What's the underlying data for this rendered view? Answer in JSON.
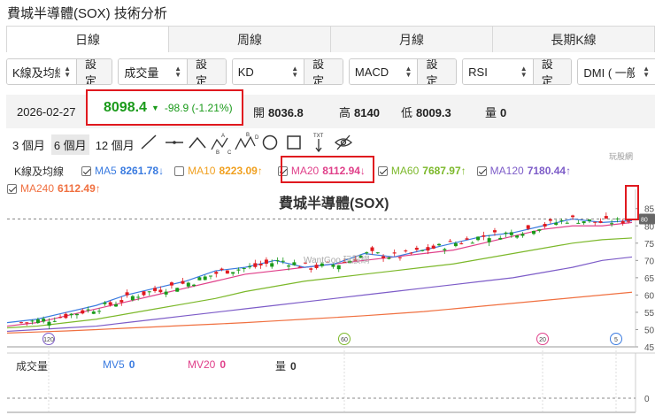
{
  "title": "費城半導體(SOX) 技術分析",
  "tabs": [
    "日線",
    "周線",
    "月線",
    "長期K線"
  ],
  "selectors": [
    {
      "value": "K線及均線",
      "button": "設定"
    },
    {
      "value": "成交量",
      "button": "設定"
    },
    {
      "value": "KD",
      "button": "設定"
    },
    {
      "value": "MACD",
      "button": "設定"
    },
    {
      "value": "RSI",
      "button": "設定"
    },
    {
      "value": "DMI ( 一般",
      "button": ""
    }
  ],
  "quote": {
    "date": "2026-02-27",
    "price": "8098.4",
    "price_arrow": "▼",
    "change": "-98.9 (-1.21%)",
    "open_label": "開",
    "open": "8036.8",
    "high_label": "高",
    "high": "8140",
    "low_label": "低",
    "low": "8009.3",
    "vol_label": "量",
    "vol": "0"
  },
  "ranges": [
    "3 個月",
    "6 個月",
    "12 個月"
  ],
  "legend": {
    "kline": "K線及均線",
    "ma5": {
      "label": "MA5",
      "value": "8261.78",
      "arrow": "↓"
    },
    "ma10": {
      "label": "MA10",
      "value": "8223.09",
      "arrow": "↑"
    },
    "ma20": {
      "label": "MA20",
      "value": "8112.94",
      "arrow": "↓"
    },
    "ma60": {
      "label": "MA60",
      "value": "7687.97",
      "arrow": "↑"
    },
    "ma120": {
      "label": "MA120",
      "value": "7180.44",
      "arrow": "↑"
    },
    "ma240": {
      "label": "MA240",
      "value": "6112.49",
      "arrow": "↑"
    }
  },
  "colors": {
    "ma5": "#3a7be0",
    "ma10": "#f0a020",
    "ma20": "#e0408a",
    "ma60": "#7cb82a",
    "ma120": "#7d5cc8",
    "ma240": "#f07040",
    "up": "#e0191f",
    "down": "#1a9a1a",
    "highlight": "#e0191f"
  },
  "chart_title": "費城半導體(SOX)",
  "watermark": "WantGoo 玩股網",
  "logo": "玩股網",
  "volume": {
    "title": "成交量",
    "ma5": "MV5",
    "ma5_val": "0",
    "ma20": "MV20",
    "ma20_val": "0",
    "vol": "量",
    "vol_val": "0",
    "zero": "0"
  },
  "chart_data": {
    "type": "line",
    "title": "費城半導體(SOX)",
    "y_ticks": [
      45,
      50,
      55,
      60,
      65,
      70,
      75,
      80,
      85
    ],
    "ylim": [
      45,
      88
    ],
    "current_price_tag": "80",
    "period_markers": [
      "120",
      "60",
      "20",
      "5"
    ],
    "series": [
      {
        "name": "MA5",
        "values": [
          52,
          53,
          55,
          57,
          60,
          62,
          64,
          67,
          68,
          70,
          68,
          69,
          72,
          71,
          73,
          75,
          77,
          78,
          80,
          82,
          81,
          81.5
        ]
      },
      {
        "name": "MA20",
        "values": [
          51,
          52,
          54,
          56,
          58,
          60,
          62,
          64,
          66,
          67,
          68,
          69,
          70,
          71,
          72,
          73,
          75,
          77,
          79,
          80,
          80,
          81
        ]
      },
      {
        "name": "MA60",
        "values": [
          50.5,
          51,
          52,
          53,
          54.5,
          56,
          57.5,
          59,
          61,
          62.5,
          64,
          65,
          66,
          67,
          68,
          69,
          70.5,
          72,
          73.5,
          75,
          76,
          76.5
        ]
      },
      {
        "name": "MA120",
        "values": [
          49.5,
          50,
          50.5,
          51,
          52,
          53,
          54,
          55,
          56,
          57,
          58,
          59,
          60,
          61,
          62,
          63,
          64,
          65,
          66.5,
          68,
          70,
          71
        ]
      },
      {
        "name": "MA240",
        "values": [
          49,
          49.3,
          49.6,
          50,
          50.4,
          50.8,
          51.2,
          51.6,
          52,
          52.5,
          53,
          53.5,
          54,
          54.6,
          55.2,
          56,
          56.8,
          57.6,
          58.4,
          59.2,
          60,
          60.8
        ]
      }
    ]
  }
}
